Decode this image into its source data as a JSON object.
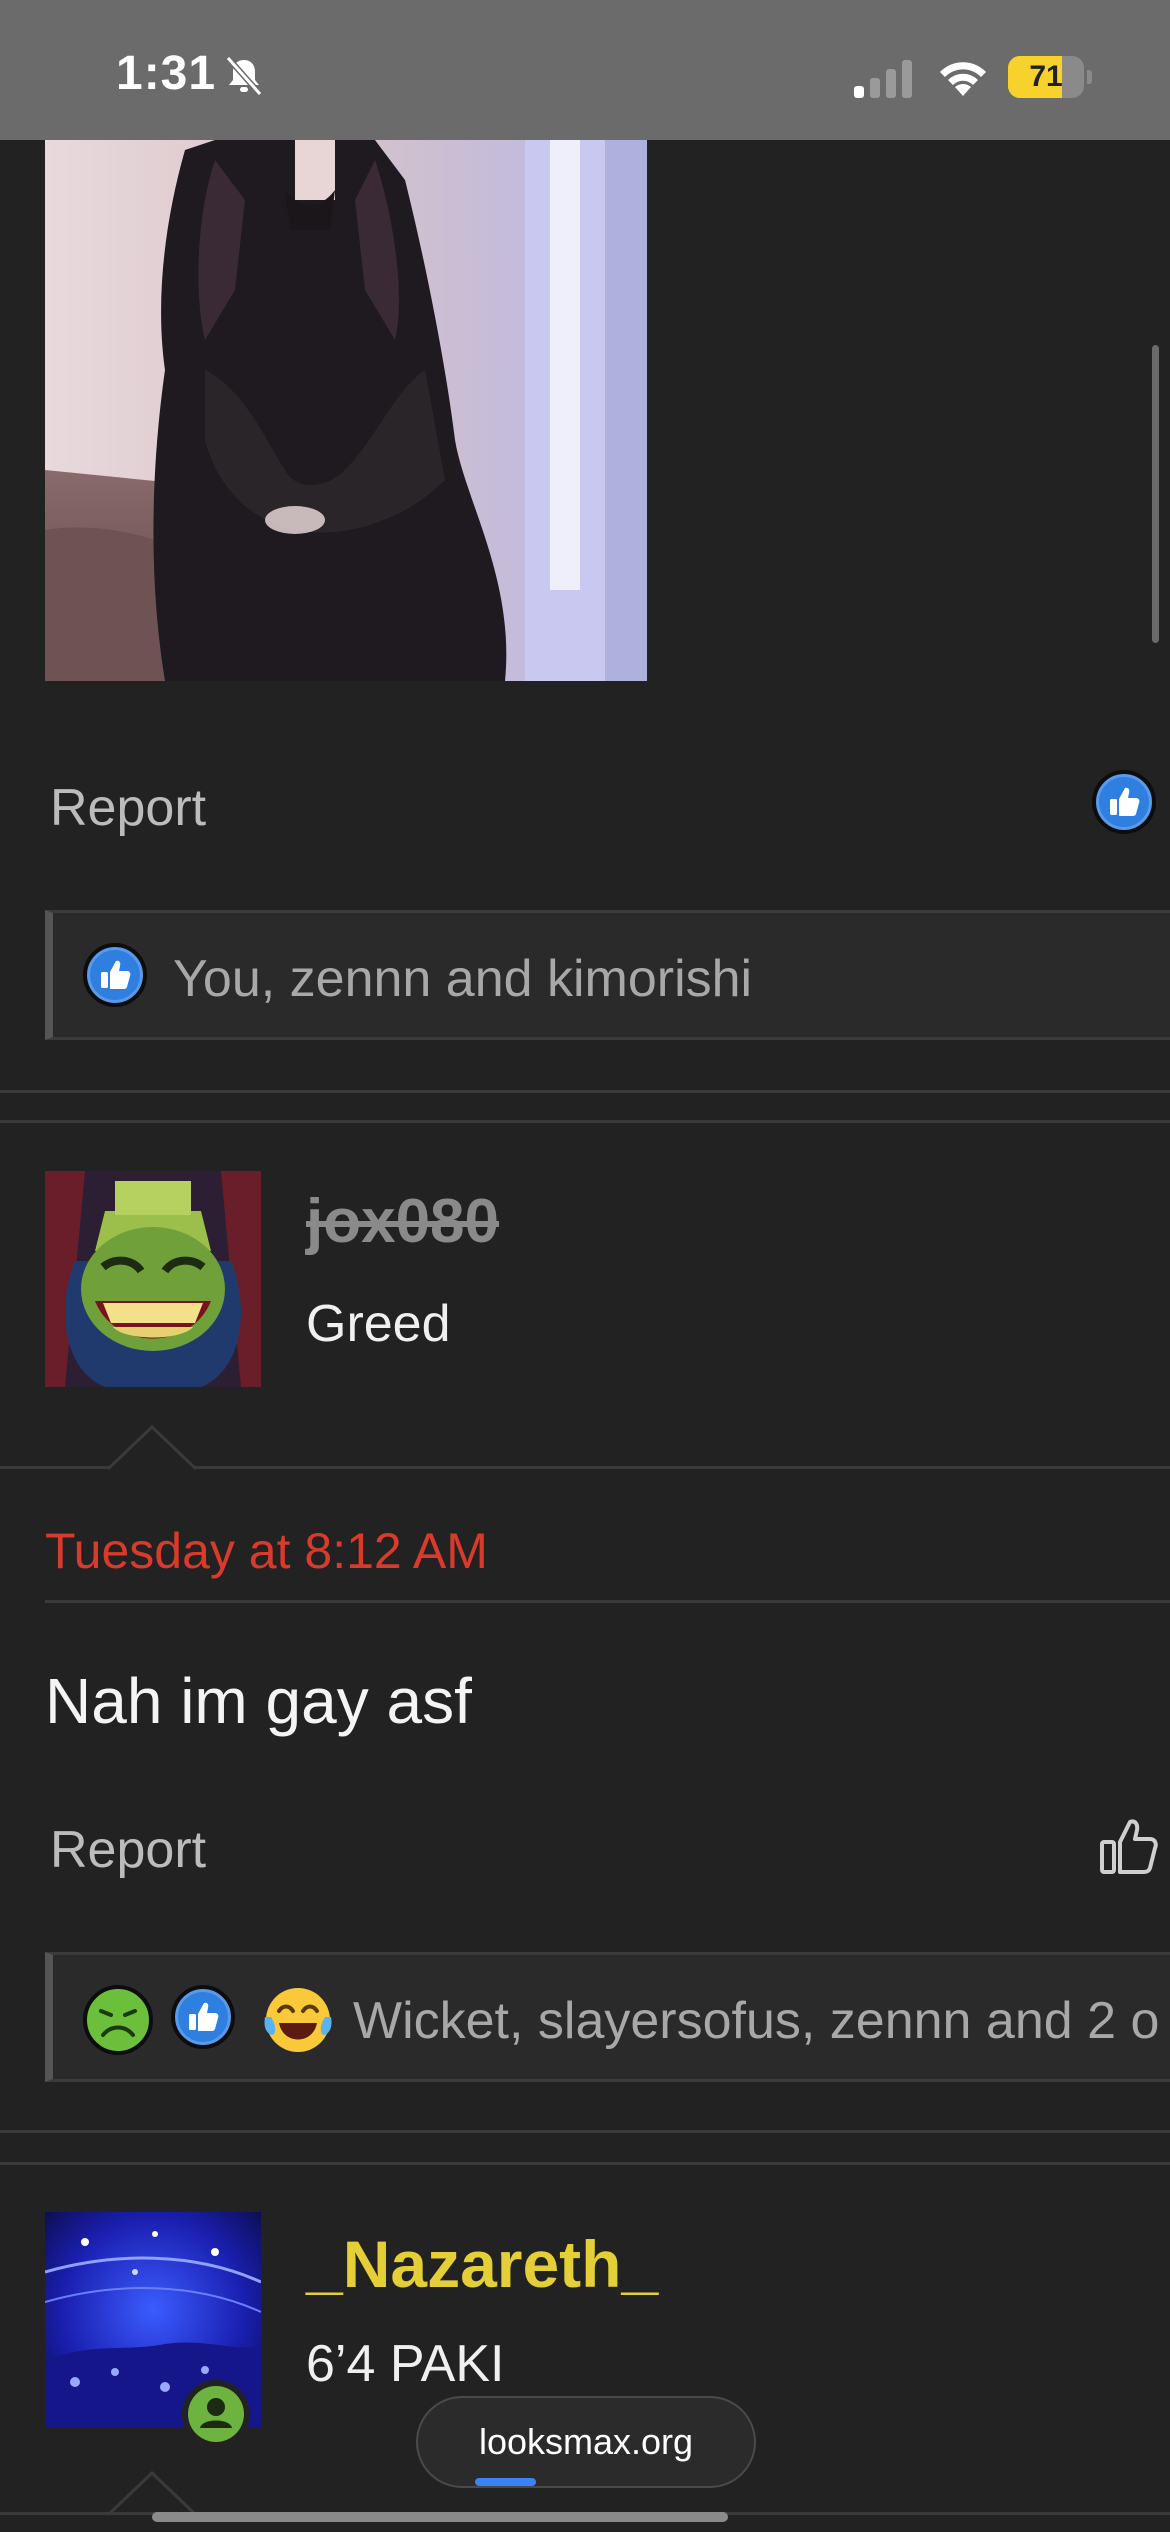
{
  "status_bar": {
    "time": "1:31",
    "battery_level": 71,
    "battery_text": "71",
    "colors": {
      "battery_fill": "#f7d12c",
      "background": "#6b6b6b"
    }
  },
  "posts": [
    {
      "report_label": "Report",
      "reaction_summary": "You, zennn and kimorishi",
      "reaction_icons": [
        "like-icon"
      ]
    },
    {
      "username": "jox080",
      "user_title": "Greed",
      "date": "Tuesday at 8:12 AM",
      "body": "Nah im gay asf",
      "report_label": "Report",
      "reaction_summary": "Wicket, slayersofus, zennn and 2 o",
      "reaction_icons": [
        "sick-face-icon",
        "like-icon",
        "laughing-crying-icon"
      ]
    },
    {
      "username": "_Nazareth_",
      "user_title": "6’4 PAKI"
    }
  ],
  "browser": {
    "url": "looksmax.org",
    "load_progress": 0.18
  },
  "colors": {
    "date_red": "#d83a2c",
    "username_gold": "#e4cf36",
    "like_blue": "#2f7fe0",
    "page_bg": "#222222"
  }
}
